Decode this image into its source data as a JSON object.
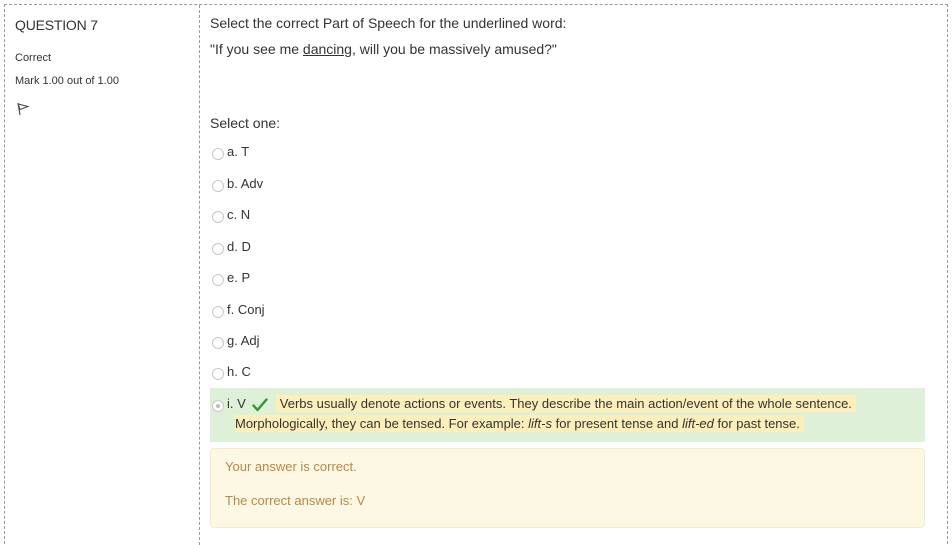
{
  "info": {
    "question_number": "QUESTION 7",
    "state": "Correct",
    "grade": "Mark 1.00 out of 1.00",
    "flag_icon": "flag-icon"
  },
  "question": {
    "prompt": "Select the correct Part of Speech for the underlined word:",
    "sentence_before": "\"If you see me ",
    "sentence_underlined": "dancing",
    "sentence_after": ", will you be massively amused?\"",
    "select_label": "Select one:",
    "options": [
      {
        "label": "a. T",
        "checked": false
      },
      {
        "label": "b. Adv",
        "checked": false
      },
      {
        "label": "c. N",
        "checked": false
      },
      {
        "label": "d. D",
        "checked": false
      },
      {
        "label": "e. P",
        "checked": false
      },
      {
        "label": "f. Conj",
        "checked": false
      },
      {
        "label": "g. Adj",
        "checked": false
      },
      {
        "label": "h. C",
        "checked": false
      },
      {
        "label": "i. V",
        "checked": true
      }
    ],
    "specific_feedback": {
      "line1": "Verbs usually denote actions or events. They describe the main action/event of the whole sentence.",
      "line2_a": "Morphologically, they can be tensed. For example: ",
      "line2_b": "lift-s",
      "line2_c": " for present tense and ",
      "line2_d": "lift-ed",
      "line2_e": " for past tense."
    }
  },
  "outcome": {
    "feedback": "Your answer is correct.",
    "right_answer": "The correct answer is: V"
  },
  "colors": {
    "correct_bg": "#dff0d8",
    "feedback_highlight": "#fcefba",
    "outcome_bg": "#fcf8e3",
    "outcome_text": "#b8884a",
    "check_green": "#2e9b2e"
  }
}
